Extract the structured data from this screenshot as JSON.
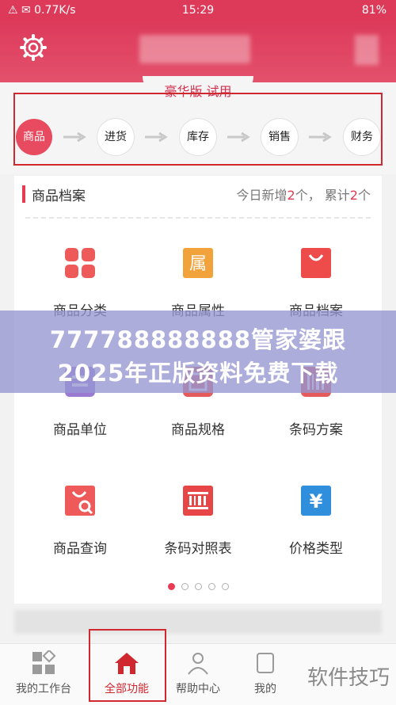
{
  "status_bar": {
    "left": "⚠ ✉ 0.77K/s",
    "time": "15:29",
    "right": "81%"
  },
  "header": {
    "edition_label": "豪华版 试用"
  },
  "flow": {
    "nodes": [
      {
        "label": "商品",
        "active": true
      },
      {
        "label": "进货",
        "active": false
      },
      {
        "label": "库存",
        "active": false
      },
      {
        "label": "销售",
        "active": false
      },
      {
        "label": "财务",
        "active": false
      }
    ]
  },
  "section": {
    "title": "商品档案",
    "stats_prefix": "今日新增",
    "stats_new": "2",
    "stats_mid": "个， 累计",
    "stats_total": "2",
    "stats_suffix": "个"
  },
  "grid": [
    {
      "label": "商品分类",
      "icon": "category-grid-icon",
      "color": "#ee5a5a"
    },
    {
      "label": "商品属性",
      "icon": "attribute-tag-icon",
      "color": "#f2a23a"
    },
    {
      "label": "商品档案",
      "icon": "shopping-bag-icon",
      "color": "#ee4b4b"
    },
    {
      "label": "商品单位",
      "icon": "unit-icon",
      "color": "#9b7bd1"
    },
    {
      "label": "商品规格",
      "icon": "spec-icon",
      "color": "#e55a5a"
    },
    {
      "label": "条码方案",
      "icon": "barcode-plan-icon",
      "color": "#e55a5a"
    },
    {
      "label": "商品查询",
      "icon": "search-bag-icon",
      "color": "#ee5a5a"
    },
    {
      "label": "条码对照表",
      "icon": "barcode-table-icon",
      "color": "#e64646"
    },
    {
      "label": "价格类型",
      "icon": "yen-price-icon",
      "color": "#2f8fdc"
    }
  ],
  "icon_glyph_attribute": "属",
  "icon_glyph_price": "¥",
  "pagination": {
    "total": 5,
    "active": 0
  },
  "nav": [
    {
      "label": "我的工作台",
      "icon": "workbench-icon",
      "active": false
    },
    {
      "label": "全部功能",
      "icon": "home-icon",
      "active": true
    },
    {
      "label": "帮助中心",
      "icon": "help-person-icon",
      "active": false
    },
    {
      "label": "我的",
      "icon": "profile-icon",
      "active": false
    }
  ],
  "overlay": {
    "line1": "777788888888管家婆跟",
    "line2": "2025年正版资料免费下载"
  },
  "watermark": "软件技巧"
}
